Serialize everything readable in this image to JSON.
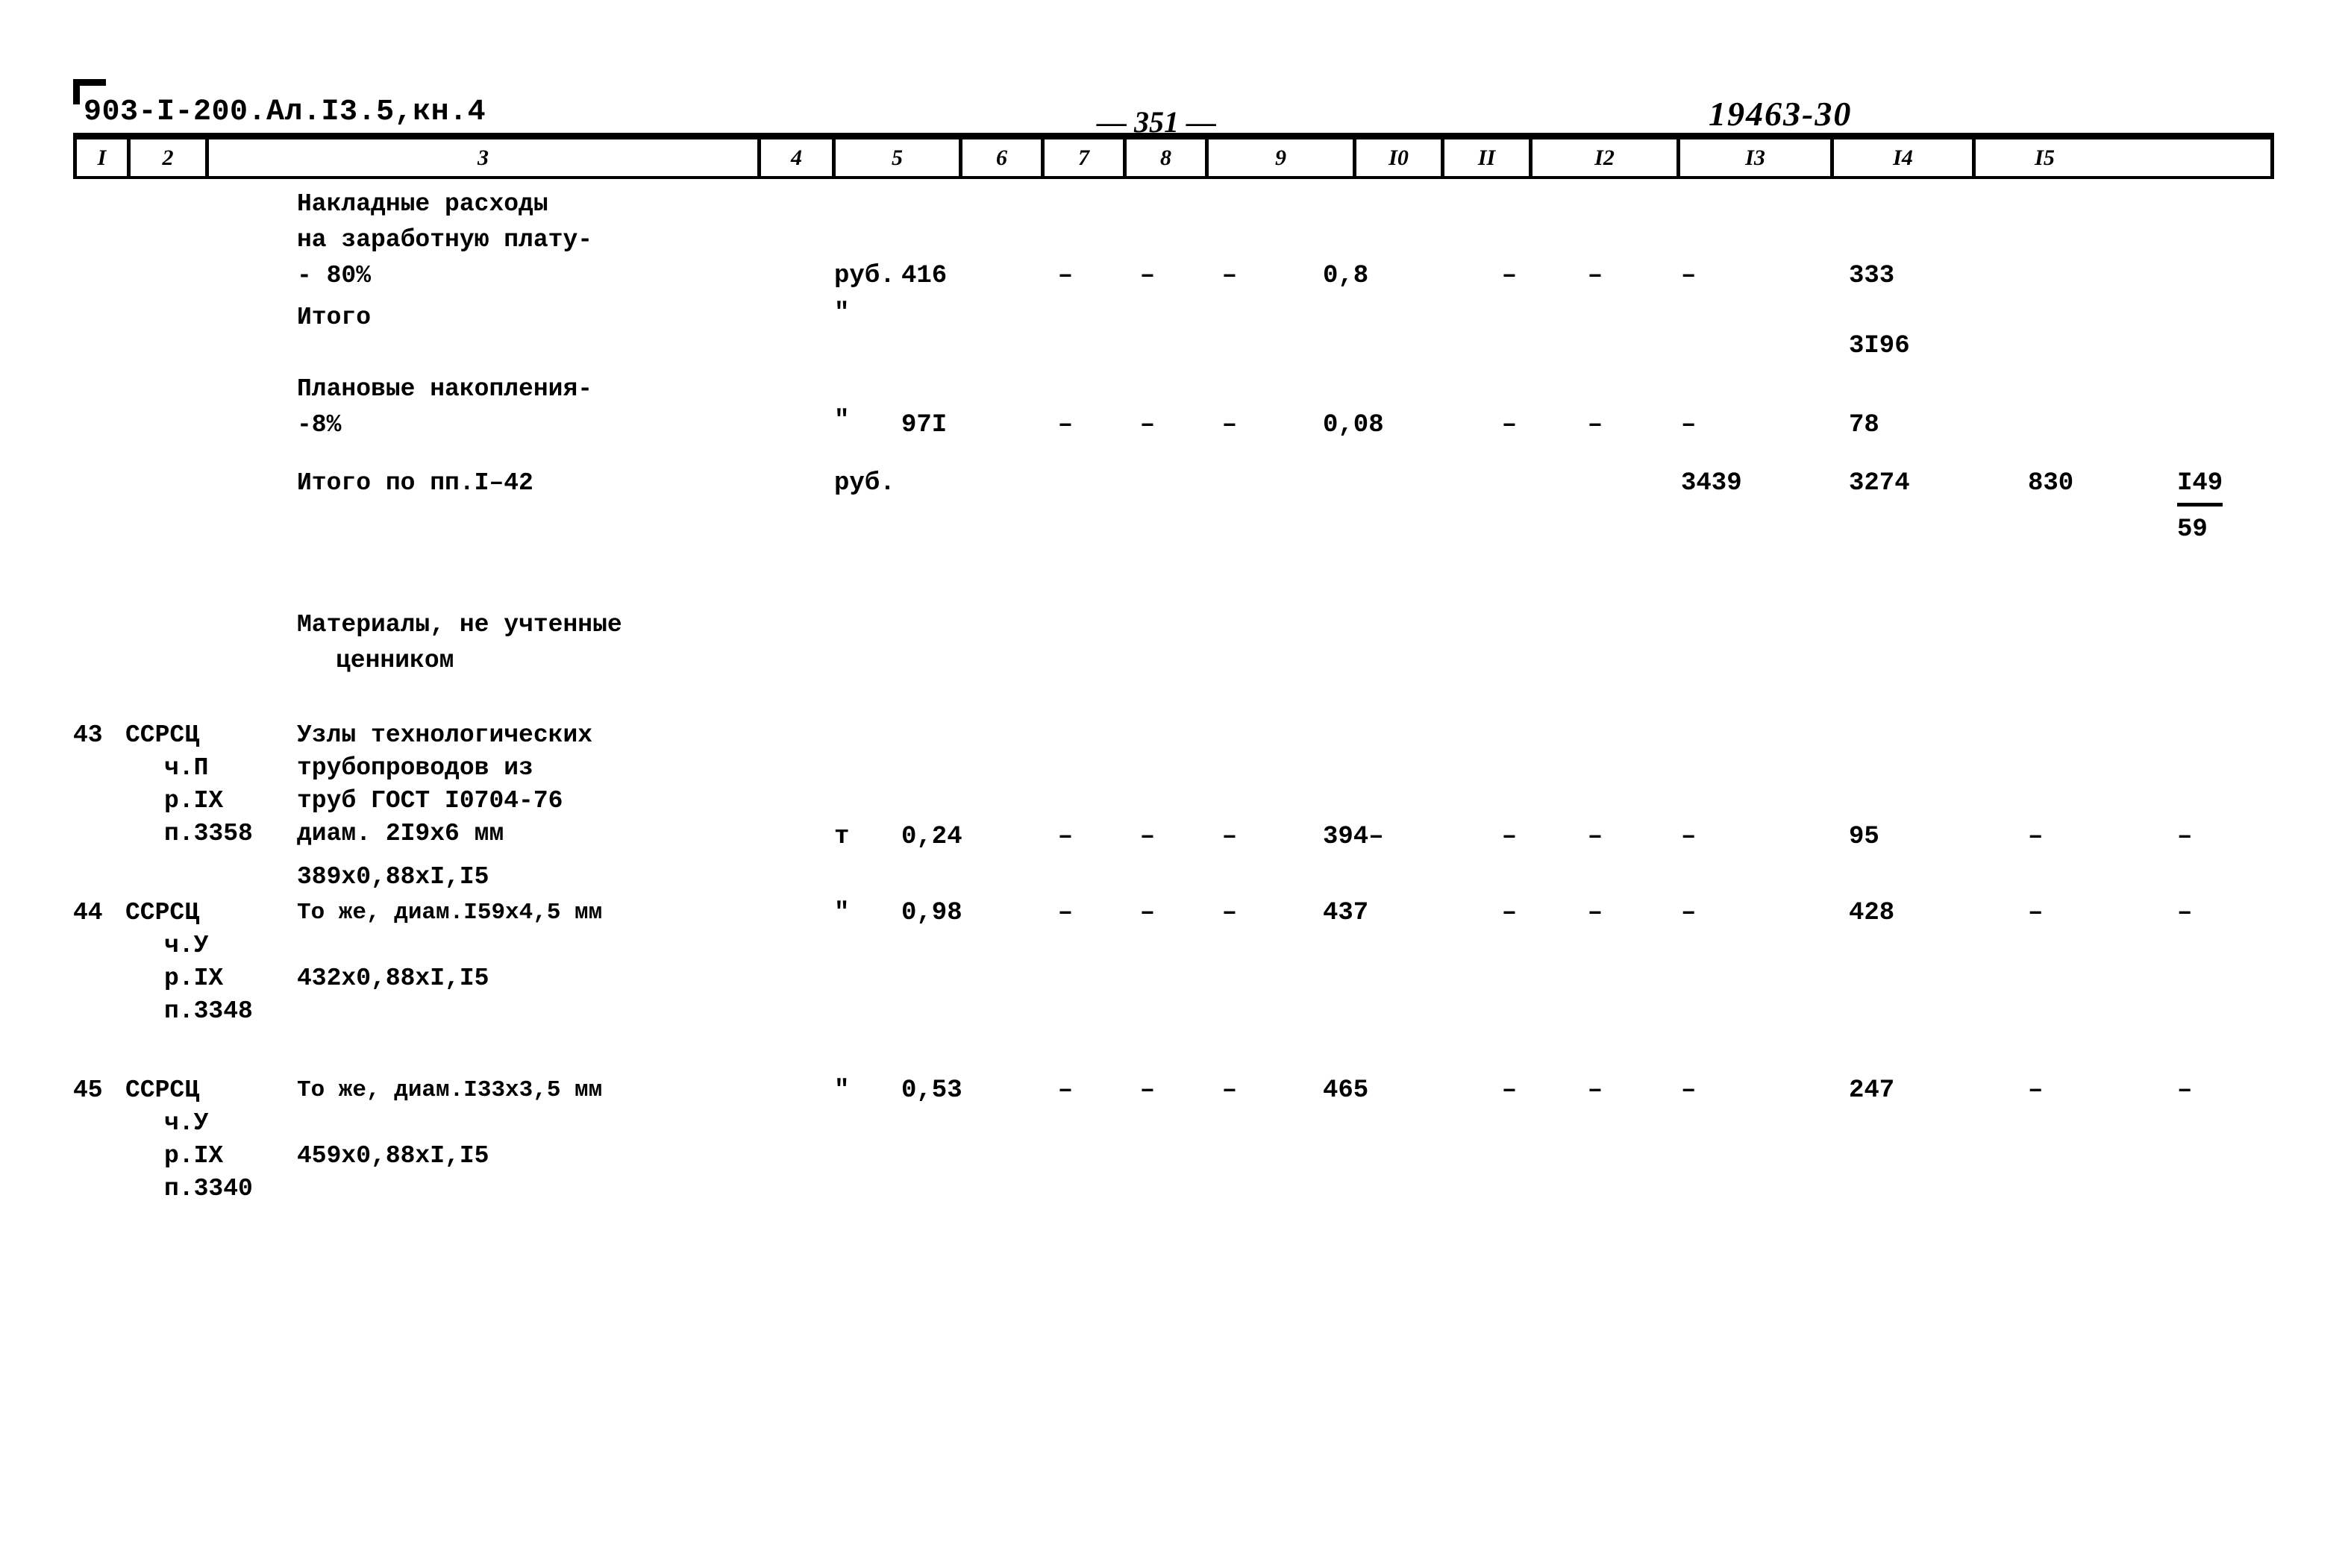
{
  "header": {
    "doc_code": "903-I-200.Ал.I3.5,кн.4",
    "page_number": "— 351 —",
    "stamp_code": "19463-30"
  },
  "column_headers": [
    "I",
    "2",
    "3",
    "4",
    "5",
    "6",
    "7",
    "8",
    "9",
    "I0",
    "II",
    "I2",
    "I3",
    "I4",
    "I5"
  ],
  "rows": [
    {
      "num": "",
      "code": "",
      "desc_line1": "Накладные расходы",
      "desc_line2": "на заработную плату-",
      "desc_line3": "- 80%",
      "unit": "руб.",
      "c5": "416",
      "c6": "–",
      "c7": "–",
      "c8": "–",
      "c9": "0,8",
      "c10": "–",
      "c11": "–",
      "c12": "–",
      "c13": "333",
      "c14": "",
      "c15": ""
    },
    {
      "num": "",
      "code": "",
      "desc_line1": "Итого",
      "unit": "\"",
      "c5": "",
      "c13": "3I96"
    },
    {
      "num": "",
      "code": "",
      "desc_line1": "Плановые накопления-",
      "desc_line2": "-8%",
      "unit": "\"",
      "c5": "97I",
      "c6": "–",
      "c7": "–",
      "c8": "–",
      "c9": "0,08",
      "c10": "–",
      "c11": "–",
      "c12": "–",
      "c13": "78",
      "c14": "",
      "c15": ""
    },
    {
      "num": "",
      "code": "",
      "desc_line1": "Итого по пп.I–42",
      "unit": "руб.",
      "c12": "3439",
      "c13": "3274",
      "c14": "830",
      "c15_top": "I49",
      "c15_bottom": "59"
    },
    {
      "section_title_line1": "Материалы, не учтенные",
      "section_title_line2": "ценником"
    },
    {
      "num": "43",
      "code_line1": "ССРСЦ",
      "code_line2": "ч.П",
      "code_line3": "р.IX",
      "code_line4": "п.3358",
      "desc_line1": "Узлы технологических",
      "desc_line2": "трубопроводов из",
      "desc_line3": "труб ГОСТ I0704-76",
      "desc_line4": "диам. 2I9х6 мм",
      "desc_line5": "389х0,88хI,I5",
      "unit": "т",
      "c5": "0,24",
      "c6": "–",
      "c7": "–",
      "c8": "–",
      "c9": "394–",
      "c10": "–",
      "c11": "–",
      "c12": "–",
      "c13": "95",
      "c14": "–",
      "c15": "–"
    },
    {
      "num": "44",
      "code_line1": "ССРСЦ",
      "code_line2": "ч.У",
      "code_line3": "р.IX",
      "code_line4": "п.3348",
      "desc_line1": "То же, диам.I59х4,5 мм",
      "desc_line2": "432х0,88хI,I5",
      "unit": "\"",
      "c5": "0,98",
      "c6": "–",
      "c7": "–",
      "c8": "–",
      "c9": "437",
      "c10": "–",
      "c11": "–",
      "c12": "–",
      "c13": "428",
      "c14": "–",
      "c15": "–"
    },
    {
      "num": "45",
      "code_line1": "ССРСЦ",
      "code_line2": "ч.У",
      "code_line3": "р.IX",
      "code_line4": "п.3340",
      "desc_line1": "То же, диам.I33х3,5 мм",
      "desc_line2": "459х0,88хI,I5",
      "unit": "\"",
      "c5": "0,53",
      "c6": "–",
      "c7": "–",
      "c8": "–",
      "c9": "465",
      "c10": "–",
      "c11": "–",
      "c12": "–",
      "c13": "247",
      "c14": "–",
      "c15": "–"
    }
  ]
}
